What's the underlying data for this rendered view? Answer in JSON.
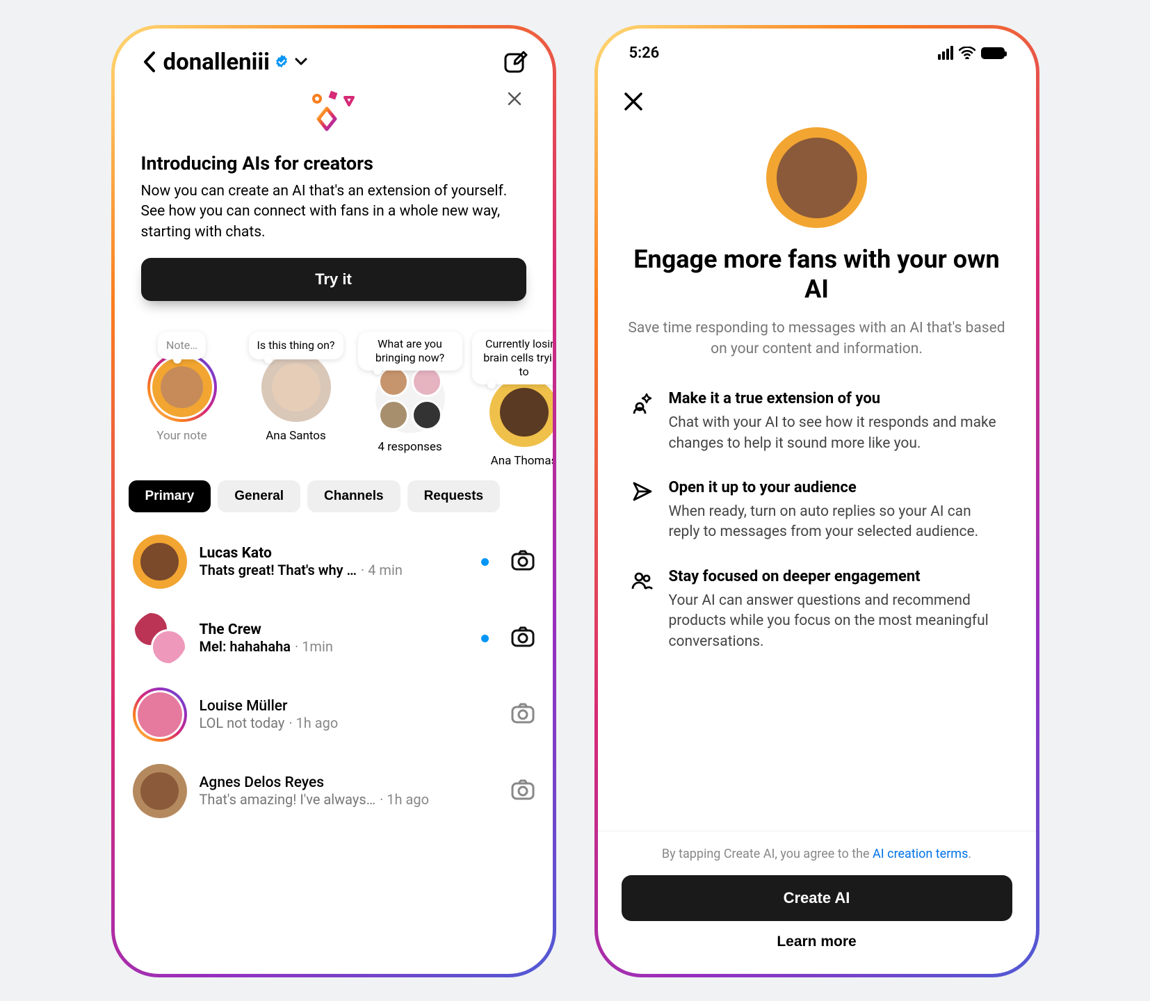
{
  "status": {
    "time": "5:26"
  },
  "left": {
    "username": "donalleniii",
    "promo": {
      "title": "Introducing AIs for creators",
      "body": "Now you can create an AI that's an extension of yourself. See how you can connect with fans in a whole new way, starting with chats.",
      "cta": "Try it"
    },
    "notes": [
      {
        "bubble": "Note…",
        "label": "Your note",
        "placeholder": true
      },
      {
        "bubble": "Is this thing on?",
        "label": "Ana Santos"
      },
      {
        "bubble": "What are you bringing now?",
        "label": "4 responses"
      },
      {
        "bubble": "Currently losing brain cells trying to",
        "label": "Ana Thomas"
      }
    ],
    "tabs": [
      "Primary",
      "General",
      "Channels",
      "Requests"
    ],
    "active_tab": 0,
    "chats": [
      {
        "name": "Lucas Kato",
        "preview": "Thats great! That's why …",
        "time": "4 min",
        "unread": true
      },
      {
        "name": "The Crew",
        "preview": "Mel: hahahaha",
        "time": "1min",
        "unread": true,
        "group": true
      },
      {
        "name": "Louise Müller",
        "preview": "LOL not today",
        "time": "1h ago",
        "unread": false,
        "ring": true
      },
      {
        "name": "Agnes Delos Reyes",
        "preview": "That's amazing! I've always…",
        "time": "1h ago",
        "unread": false
      }
    ]
  },
  "right": {
    "hero_title": "Engage more fans with your own AI",
    "hero_sub": "Save time responding to messages with an AI that's based on your content and information.",
    "features": [
      {
        "title": "Make it a true extension of you",
        "body": "Chat with your AI to see how it responds and make changes to help it sound more like you."
      },
      {
        "title": "Open it up to your audience",
        "body": "When ready, turn on auto replies so your AI can reply to messages from your selected audience."
      },
      {
        "title": "Stay focused on deeper engagement",
        "body": "Your AI can answer questions and recommend products while you focus on the most meaningful conversations."
      }
    ],
    "legal_prefix": "By tapping Create AI, you agree to the ",
    "legal_link": "AI creation terms",
    "create_cta": "Create AI",
    "learn_more": "Learn more"
  }
}
